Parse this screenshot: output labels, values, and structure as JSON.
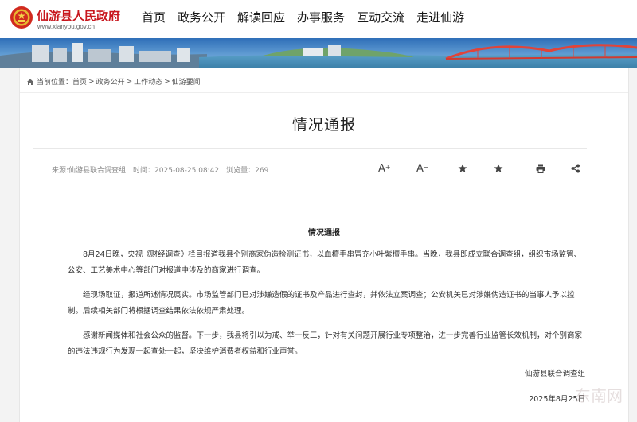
{
  "header": {
    "site_name": "仙游县人民政府",
    "site_url": "www.xianyou.gov.cn",
    "nav": [
      "首页",
      "政务公开",
      "解读回应",
      "办事服务",
      "互动交流",
      "走进仙游"
    ]
  },
  "breadcrumb": {
    "prefix": "当前位置：",
    "items": [
      "首页",
      "政务公开",
      "工作动态",
      "仙游要闻"
    ],
    "separator": ">"
  },
  "article": {
    "title": "情况通报",
    "meta": {
      "source": "来源:仙游县联合调查组",
      "time": "时间：2025-08-25 08:42",
      "views": "浏览量：269"
    },
    "tools": {
      "font_larger": "A",
      "font_larger_suffix": "+",
      "font_smaller": "A",
      "font_smaller_suffix": "−"
    },
    "heading": "情况通报",
    "paragraphs": [
      "8月24日晚，央视《财经调查》栏目报道我县个别商家伪造检测证书，以血檀手串冒充小叶紫檀手串。当晚，我县即成立联合调查组，组织市场监管、公安、工艺美术中心等部门对报道中涉及的商家进行调查。",
      "经现场取证，报道所述情况属实。市场监管部门已对涉嫌造假的证书及产品进行查封，并依法立案调查；公安机关已对涉嫌伪造证书的当事人予以控制。后续相关部门将根据调查结果依法依规严肃处理。",
      "感谢新闻媒体和社会公众的监督。下一步，我县将引以为戒、举一反三，针对有关问题开展行业专项整治，进一步完善行业监管长效机制，对个别商家的违法违规行为发现一起查处一起，坚决维护消费者权益和行业声誉。"
    ],
    "signature": "仙游县联合调查组",
    "date": "2025年8月25日"
  },
  "watermark": "东南网",
  "colors": {
    "brand_red": "#c8161d",
    "sky": "#3f8fd0",
    "bridge": "#e0443a"
  },
  "icons": [
    "national-emblem-icon",
    "home-icon",
    "star-icon",
    "print-icon",
    "share-icon"
  ]
}
